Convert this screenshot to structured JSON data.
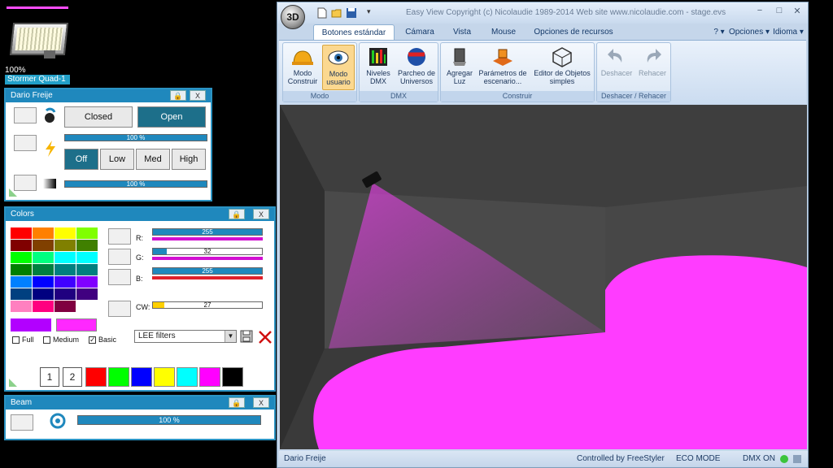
{
  "fixture": {
    "percent": "100%",
    "name": "Stormer Quad-1"
  },
  "panel1": {
    "title": "Dario Freije",
    "lock_icon": "lock-icon",
    "close": "X",
    "shutter": {
      "closed_label": "Closed",
      "open_label": "Open",
      "active": "Open"
    },
    "dimmer_slider": "100 %",
    "strobe": {
      "off_label": "Off",
      "low_label": "Low",
      "med_label": "Med",
      "high_label": "High",
      "active": "Off"
    },
    "intensity_slider": "100 %"
  },
  "colors_panel": {
    "title": "Colors",
    "close": "X",
    "palette": [
      [
        "#ff0000",
        "#ff8000",
        "#ffff00",
        "#80ff00"
      ],
      [
        "#800000",
        "#804000",
        "#808000",
        "#408000"
      ],
      [
        "#00ff00",
        "#00ff80",
        "#00ffff",
        "#00ffff"
      ],
      [
        "#008000",
        "#008040",
        "#008080",
        "#008080"
      ],
      [
        "#0080ff",
        "#0000ff",
        "#4000ff",
        "#8000ff"
      ],
      [
        "#004080",
        "#000080",
        "#200080",
        "#400080"
      ],
      [
        "#ff80c0",
        "#ff0080",
        "#800040",
        "#ffffff"
      ]
    ],
    "r": {
      "label": "R:",
      "value": "255",
      "fraction": 1.0
    },
    "g": {
      "label": "G:",
      "value": "32",
      "fraction": 0.125
    },
    "b": {
      "label": "B:",
      "value": "255",
      "fraction": 1.0
    },
    "cw": {
      "label": "CW:",
      "value": "27",
      "fraction": 0.106
    },
    "preview_colors": [
      "#b200ff",
      "#ff28ff"
    ],
    "modes": [
      {
        "label": "Full",
        "checked": false
      },
      {
        "label": "Medium",
        "checked": false
      },
      {
        "label": "Basic",
        "checked": true
      }
    ],
    "filter_select": "LEE filters",
    "presets": [
      "1",
      "2"
    ],
    "quick_colors": [
      "#ff0000",
      "#00ff00",
      "#0000ff",
      "#ffff00",
      "#00ffff",
      "#ff00ff",
      "#000000"
    ]
  },
  "beam_panel": {
    "title": "Beam",
    "close": "X",
    "slider": "100 %"
  },
  "window": {
    "logo": "3D",
    "title": "Easy View   Copyright (c) Nicolaudie 1989-2014   Web site www.nicolaudie.com - stage.evs",
    "tabs": [
      "Botones estándar",
      "Cámara",
      "Vista",
      "Mouse",
      "Opciones de recursos"
    ],
    "active_tab": "Botones estándar",
    "help": "? ▾",
    "opciones": "Opciones ▾",
    "idioma": "Idioma ▾",
    "minimize": "−",
    "maximize": "□",
    "close": "✕"
  },
  "ribbon": {
    "groups": [
      {
        "label": "Modo",
        "buttons": [
          {
            "label": "Modo Construir",
            "icon": "hardhat-icon"
          },
          {
            "label": "Modo usuario",
            "icon": "eye-icon",
            "selected": true
          }
        ]
      },
      {
        "label": "DMX",
        "buttons": [
          {
            "label": "Niveles DMX",
            "icon": "dmx-levels-icon"
          },
          {
            "label": "Parcheo de Universos",
            "icon": "dmx-patch-icon"
          }
        ]
      },
      {
        "label": "Construir",
        "buttons": [
          {
            "label": "Agregar Luz",
            "icon": "spotlight-icon"
          },
          {
            "label": "Parámetros de escenario...",
            "icon": "stage-icon"
          },
          {
            "label": "Editor de Objetos simples",
            "icon": "cube-icon"
          }
        ]
      },
      {
        "label": "Deshacer / Rehacer",
        "buttons": [
          {
            "label": "Deshacer",
            "icon": "undo-icon"
          },
          {
            "label": "Rehacer",
            "icon": "redo-icon"
          }
        ]
      }
    ]
  },
  "status": {
    "user": "Dario Freije",
    "controlled": "Controlled by FreeStyler",
    "eco": "ECO MODE",
    "dmx": "DMX ON"
  },
  "colors": {
    "accent": "#1f88bd",
    "beam": "#e040e0",
    "floor": "#ff44ff"
  }
}
